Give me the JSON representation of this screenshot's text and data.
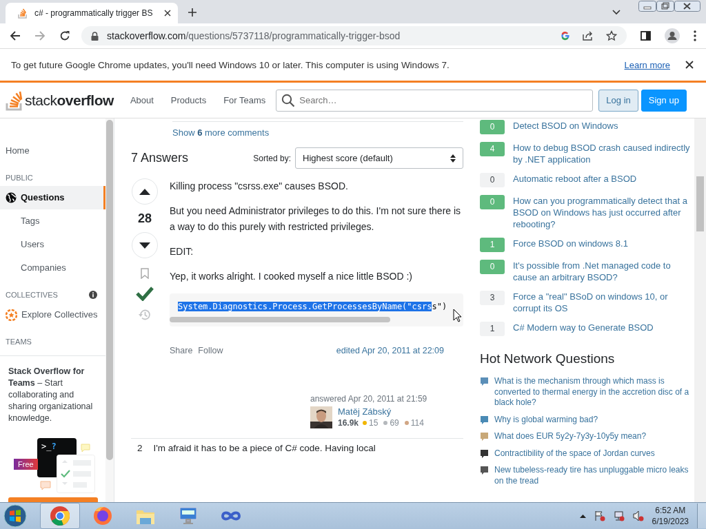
{
  "browser": {
    "tabs": [
      {
        "title": "c# - programmatically trigger BS",
        "selected": true
      }
    ],
    "url": {
      "host": "stackoverflow.com",
      "path": "/questions/5737118/programmatically-trigger-bsod"
    },
    "infobar": {
      "message": "To get future Google Chrome updates, you'll need Windows 10 or later. This computer is using Windows 7.",
      "link": "Learn more"
    }
  },
  "header": {
    "logo": "stack**overflow**",
    "nav": [
      "About",
      "Products",
      "For Teams"
    ],
    "search": {
      "placeholder": "Search…"
    },
    "login": "Log in",
    "signup": "Sign up"
  },
  "sidebar": {
    "items": [
      {
        "kind": "link",
        "label": "Home",
        "selected": false
      },
      {
        "kind": "heading",
        "label": "PUBLIC"
      },
      {
        "kind": "globe",
        "label": "Questions",
        "selected": true
      },
      {
        "kind": "sublink",
        "label": "Tags",
        "selected": false
      },
      {
        "kind": "sublink",
        "label": "Users",
        "selected": false
      },
      {
        "kind": "sublink",
        "label": "Companies",
        "selected": false
      },
      {
        "kind": "heading",
        "label": "COLLECTIVES",
        "info": true
      },
      {
        "kind": "collective",
        "label": "Explore Collectives",
        "selected": false
      },
      {
        "kind": "heading",
        "label": "TEAMS"
      }
    ],
    "teams": {
      "text": "**Stack Overflow for Teams** – Start collaborating and sharing organizational knowledge.",
      "prompt": ">_",
      "mark": "?",
      "badge": "Free"
    }
  },
  "main": {
    "comments_link": "Show **6** more comments",
    "answers_title": "7 Answers",
    "sort_label": "Sorted by:",
    "sort_value": "Highest score (default)",
    "answer": {
      "votes": "28",
      "accepted": true,
      "paragraphs": [
        "Killing process \"csrss.exe\" causes BSOD.",
        "But you need Administrator privileges to do this. I'm not sure there is a way to do this purely with restricted privileges.",
        "EDIT:",
        "Yep, it works alright. I cooked myself a nice little BSOD :)"
      ],
      "code": [
        {
          "text": "System.Diagnostics.Process.GetProcessesByName(\"csrs",
          "selected": true
        },
        {
          "text": "s\")",
          "selected": false
        }
      ],
      "actions": [
        "Share",
        "Follow"
      ],
      "edited": "edited Apr 20, 2011 at 22:09",
      "answered": "answered Apr 20, 2011 at 21:59",
      "author": {
        "name": "Matěj Zábský",
        "reputation": "16.9k",
        "badges": [
          {
            "count": "15",
            "color": "#f1b600"
          },
          {
            "count": "69",
            "color": "#b4b8bc"
          },
          {
            "count": "114",
            "color": "#d1a684"
          }
        ]
      }
    },
    "next_answer": {
      "votes": "2",
      "text": "I'm afraid it has to be a piece of C# code. Having local"
    }
  },
  "linked": [
    {
      "score": "0",
      "accepted": true,
      "title": "Detect BSOD on Windows"
    },
    {
      "score": "4",
      "accepted": true,
      "title": "How to debug BSOD crash caused indirectly by .NET application"
    },
    {
      "score": "0",
      "accepted": false,
      "title": "Automatic reboot after a BSOD"
    },
    {
      "score": "0",
      "accepted": true,
      "title": "How can you programmatically detect that a BSOD on Windows has just occurred after rebooting?"
    },
    {
      "score": "1",
      "accepted": true,
      "title": "Force BSOD on windows 8.1"
    },
    {
      "score": "0",
      "accepted": true,
      "title": "It's possible from .Net managed code to cause an arbitrary BSOD?"
    },
    {
      "score": "3",
      "accepted": false,
      "title": "Force a \"real\" BSoD on windows 10, or corrupt its OS"
    },
    {
      "score": "1",
      "accepted": false,
      "title": "C# Modern way to Generate BSOD"
    }
  ],
  "hot": {
    "title": "Hot Network Questions",
    "items": [
      {
        "title": "What is the mechanism through which mass is converted to thermal energy in the accretion disc of a black hole?",
        "color": "#5b8fb8"
      },
      {
        "title": "Why is global warming bad?",
        "color": "#4a8ab5"
      },
      {
        "title": "What does EUR 5y2y-7y3y-10y5y mean?",
        "color": "#c8a878"
      },
      {
        "title": "Contractibility of the space of Jordan curves",
        "color": "#333333"
      },
      {
        "title": "New tubeless-ready tire has unpluggable micro leaks on the tread",
        "color": "#555555"
      }
    ]
  },
  "taskbar": {
    "apps": [
      {
        "kind": "chrome",
        "selected": true
      },
      {
        "kind": "firefox",
        "selected": false
      },
      {
        "kind": "explorer",
        "selected": false
      },
      {
        "kind": "remote",
        "selected": false
      },
      {
        "kind": "infinity",
        "selected": false
      }
    ],
    "time": "6:52 AM",
    "date": "6/19/2023"
  }
}
